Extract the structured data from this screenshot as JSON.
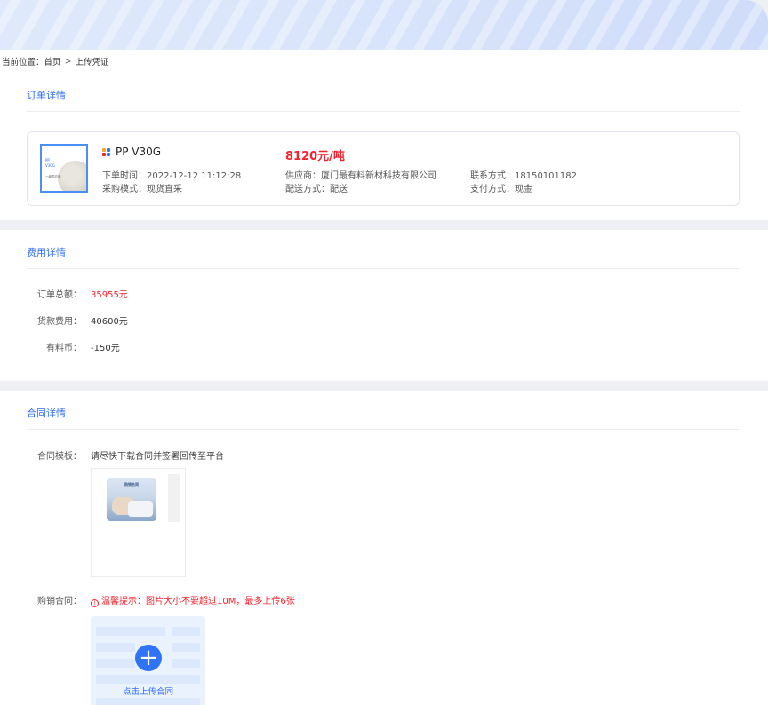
{
  "breadcrumb": {
    "prefix": "当前位置：",
    "home": "首页",
    "separator": ">",
    "current": "上传凭证"
  },
  "order": {
    "title": "订单详情",
    "thumb": {
      "line1": "PP",
      "line2": "V30G",
      "line3": "一级供应商"
    },
    "product_name": "PP V30G",
    "price": "8120元/吨",
    "order_time": "下单时间：2022-12-12 11:12:28",
    "purchase_mode": "采购模式：现货直采",
    "supplier": "供应商：厦门最有料新材科技有限公司",
    "delivery": "配送方式：配送",
    "contact": "联系方式：18150101182",
    "payment": "支付方式：现金",
    "icon_colors": [
      "#f5a623",
      "#2f74f5",
      "#f5222d",
      "#2f74f5"
    ]
  },
  "fees": {
    "title": "费用详情",
    "rows": [
      {
        "label": "订单总额：",
        "value": "35955元",
        "color": "#f5222d"
      },
      {
        "label": "货款费用：",
        "value": "40600元",
        "color": "#333333"
      },
      {
        "label": "有料币：",
        "value": "-150元",
        "color": "#333333"
      }
    ]
  },
  "contract": {
    "title": "合同详情",
    "template_label": "合同模板：",
    "template_hint": "请尽快下载合同并签署回传至平台",
    "template_thumb_title": "购销合同",
    "purchase_label": "购销合同：",
    "warning_icon": "!",
    "warning": "温馨提示：图片大小不要超过10M，最多上传6张",
    "upload_label": "点击上传合同",
    "upload_icon": "+"
  },
  "colors": {
    "accent": "#2f6df6",
    "price_red": "#f5222d"
  }
}
